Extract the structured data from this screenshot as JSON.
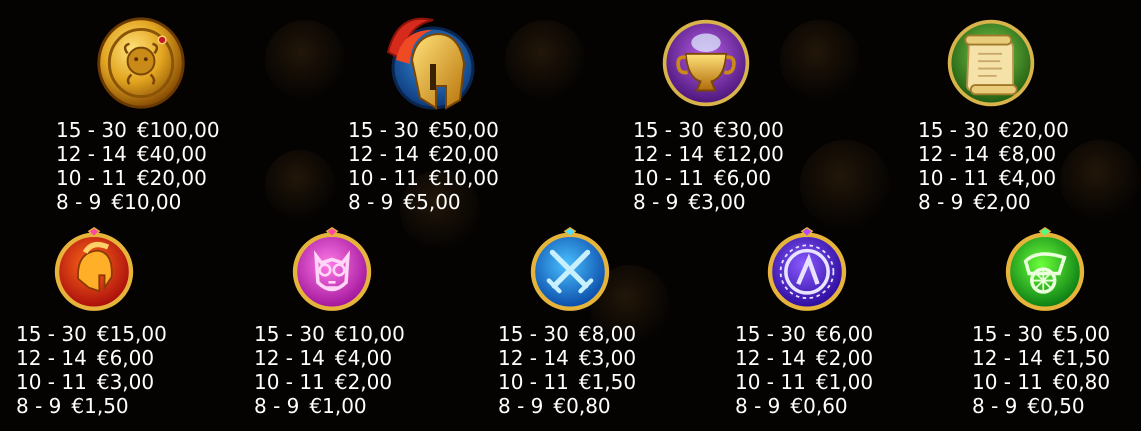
{
  "paytable": {
    "row1": [
      {
        "symbol_icon": "gold-medusa-coin-icon",
        "payouts": [
          {
            "range": "15 - 30",
            "prize": "€100,00"
          },
          {
            "range": "12 - 14",
            "prize": "€40,00"
          },
          {
            "range": "10 - 11",
            "prize": "€20,00"
          },
          {
            "range": "8 - 9",
            "prize": "€10,00"
          }
        ]
      },
      {
        "symbol_icon": "spartan-helmet-icon",
        "payouts": [
          {
            "range": "15 - 30",
            "prize": "€50,00"
          },
          {
            "range": "12 - 14",
            "prize": "€20,00"
          },
          {
            "range": "10 - 11",
            "prize": "€10,00"
          },
          {
            "range": "8 - 9",
            "prize": "€5,00"
          }
        ]
      },
      {
        "symbol_icon": "golden-urn-icon",
        "payouts": [
          {
            "range": "15 - 30",
            "prize": "€30,00"
          },
          {
            "range": "12 - 14",
            "prize": "€12,00"
          },
          {
            "range": "10 - 11",
            "prize": "€6,00"
          },
          {
            "range": "8 - 9",
            "prize": "€3,00"
          }
        ]
      },
      {
        "symbol_icon": "scroll-icon",
        "payouts": [
          {
            "range": "15 - 30",
            "prize": "€20,00"
          },
          {
            "range": "12 - 14",
            "prize": "€8,00"
          },
          {
            "range": "10 - 11",
            "prize": "€4,00"
          },
          {
            "range": "8 - 9",
            "prize": "€2,00"
          }
        ]
      }
    ],
    "row2": [
      {
        "symbol_icon": "red-helmet-gem-icon",
        "payouts": [
          {
            "range": "15 - 30",
            "prize": "€15,00"
          },
          {
            "range": "12 - 14",
            "prize": "€6,00"
          },
          {
            "range": "10 - 11",
            "prize": "€3,00"
          },
          {
            "range": "8 - 9",
            "prize": "€1,50"
          }
        ]
      },
      {
        "symbol_icon": "pink-owl-gem-icon",
        "payouts": [
          {
            "range": "15 - 30",
            "prize": "€10,00"
          },
          {
            "range": "12 - 14",
            "prize": "€4,00"
          },
          {
            "range": "10 - 11",
            "prize": "€2,00"
          },
          {
            "range": "8 - 9",
            "prize": "€1,00"
          }
        ]
      },
      {
        "symbol_icon": "blue-crossed-swords-gem-icon",
        "payouts": [
          {
            "range": "15 - 30",
            "prize": "€8,00"
          },
          {
            "range": "12 - 14",
            "prize": "€3,00"
          },
          {
            "range": "10 - 11",
            "prize": "€1,50"
          },
          {
            "range": "8 - 9",
            "prize": "€0,80"
          }
        ]
      },
      {
        "symbol_icon": "purple-shield-gem-icon",
        "payouts": [
          {
            "range": "15 - 30",
            "prize": "€6,00"
          },
          {
            "range": "12 - 14",
            "prize": "€2,00"
          },
          {
            "range": "10 - 11",
            "prize": "€1,00"
          },
          {
            "range": "8 - 9",
            "prize": "€0,60"
          }
        ]
      },
      {
        "symbol_icon": "green-chariot-gem-icon",
        "payouts": [
          {
            "range": "15 - 30",
            "prize": "€5,00"
          },
          {
            "range": "12 - 14",
            "prize": "€1,50"
          },
          {
            "range": "10 - 11",
            "prize": "€0,80"
          },
          {
            "range": "8 - 9",
            "prize": "€0,50"
          }
        ]
      }
    ]
  }
}
